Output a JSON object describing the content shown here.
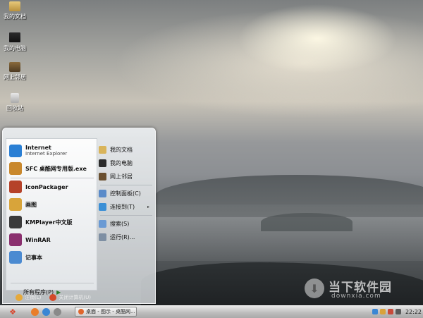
{
  "desktop": {
    "icons": [
      {
        "label": "我的文档",
        "icon": "my-documents-icon"
      },
      {
        "label": "我的电脑",
        "icon": "my-computer-icon"
      },
      {
        "label": "网上邻居",
        "icon": "network-places-icon"
      },
      {
        "label": "回收站",
        "icon": "recycle-bin-icon"
      }
    ]
  },
  "start_menu": {
    "programs": [
      {
        "label": "Internet",
        "sub": "Internet Explorer",
        "icon": "internet-explorer-icon",
        "color": "#2a7fd4"
      },
      {
        "label": "SFC 桌酷网专用版.exe",
        "icon": "sfc-app-icon",
        "color": "#c9882d"
      },
      {
        "label": "IconPackager",
        "icon": "iconpackager-icon",
        "color": "#b5422a"
      },
      {
        "label": "画图",
        "icon": "paint-icon",
        "color": "#d8a43a"
      },
      {
        "label": "KMPlayer中文版",
        "icon": "kmplayer-icon",
        "color": "#3a3a3a"
      },
      {
        "label": "WinRAR",
        "icon": "winrar-icon",
        "color": "#8a2f6e"
      },
      {
        "label": "记事本",
        "icon": "notepad-icon",
        "color": "#4b8ad1"
      }
    ],
    "all_programs": "所有程序(P)",
    "places": [
      {
        "label": "我的文档",
        "icon": "my-documents-icon",
        "color": "#d9b45a"
      },
      {
        "label": "我的电脑",
        "icon": "my-computer-icon",
        "color": "#2b2b2b"
      },
      {
        "label": "网上邻居",
        "icon": "network-places-icon",
        "color": "#6b5030"
      },
      {
        "label": "控制面板(C)",
        "icon": "control-panel-icon",
        "color": "#5a8bc9"
      },
      {
        "label": "连接到(T)",
        "icon": "connect-to-icon",
        "color": "#3b8fd6",
        "arrow": "▸"
      },
      {
        "label": "搜索(S)",
        "icon": "search-icon",
        "color": "#6a9ad4"
      },
      {
        "label": "运行(R)...",
        "icon": "run-icon",
        "color": "#7e8fa3"
      }
    ],
    "logoff": "注销(L)",
    "shutdown": "关闭计算机(U)"
  },
  "taskbar": {
    "task_label": "桌面 - 图示 - 桌酷网...",
    "clock": "22:22"
  },
  "watermark": {
    "title": "当下软件园",
    "url": "downxia.com"
  }
}
